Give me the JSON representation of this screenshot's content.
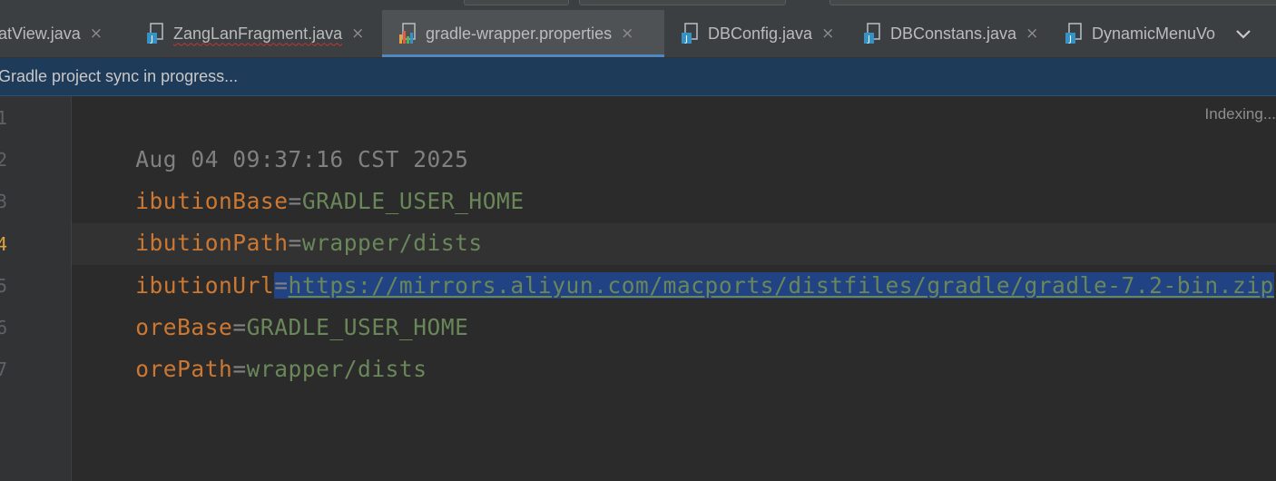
{
  "tabs": [
    {
      "label": "hatView.java",
      "close": "×",
      "icon": "java-file-icon"
    },
    {
      "label": "ZangLanFragment.java",
      "close": "×",
      "icon": "java-file-icon"
    },
    {
      "label": "gradle-wrapper.properties",
      "close": "×",
      "icon": "properties-file-icon",
      "active": true
    },
    {
      "label": "DBConfig.java",
      "close": "×",
      "icon": "java-file-icon"
    },
    {
      "label": "DBConstans.java",
      "close": "×",
      "icon": "java-file-icon"
    },
    {
      "label": "DynamicMenuVo",
      "icon": "java-file-icon"
    }
  ],
  "notification": {
    "text": "Gradle project sync in progress..."
  },
  "editor": {
    "status": "Indexing...",
    "line_numbers": [
      "1",
      "2",
      "3",
      "4",
      "5",
      "6",
      "7"
    ],
    "lines": [
      {
        "comment": "Aug 04 09:37:16 CST 2025"
      },
      {
        "key": "ibutionBase",
        "eq": "=",
        "value": "GRADLE_USER_HOME"
      },
      {
        "key": "ibutionPath",
        "eq": "=",
        "value": "wrapper/dists"
      },
      {
        "key": "ibutionUrl",
        "eq": "=",
        "value": "https://mirrors.aliyun.com/macports/distfiles/gradle/gradle-7.2-bin.zip"
      },
      {
        "key": "oreBase",
        "eq": "=",
        "value": "GRADLE_USER_HOME"
      },
      {
        "key": "orePath",
        "eq": "=",
        "value": "wrapper/dists"
      }
    ]
  },
  "colors": {
    "background": "#2b2b2b",
    "key": "#cc7832",
    "value": "#6a8759",
    "comment": "#808080",
    "selection": "#214283",
    "notification_bg": "#1e3b5a"
  }
}
